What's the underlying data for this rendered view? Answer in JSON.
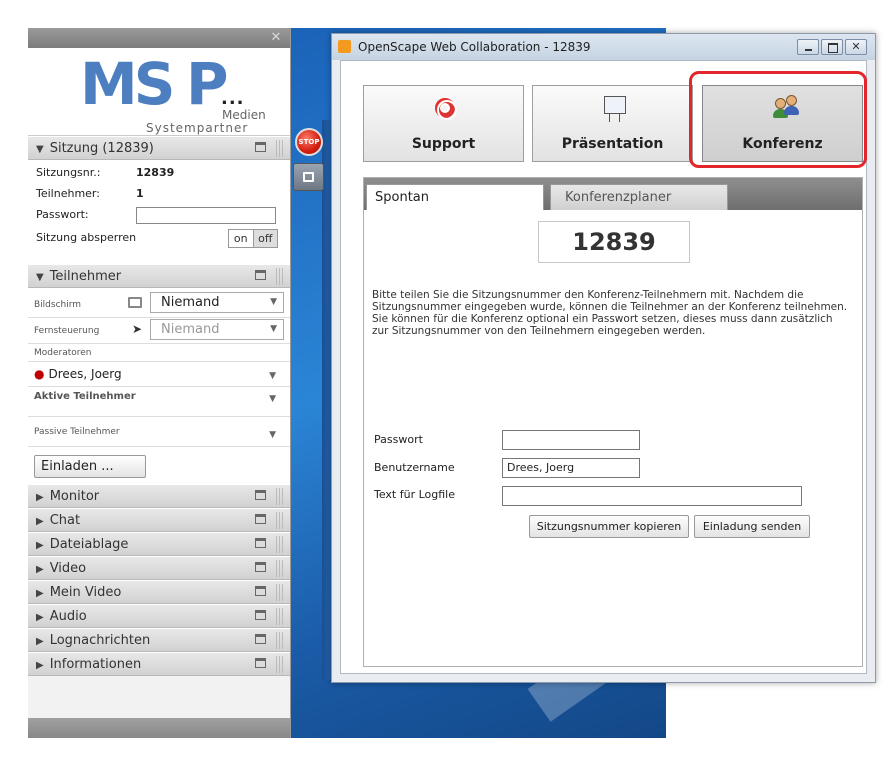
{
  "left_panel": {
    "close": "✕",
    "logo": {
      "ms": "MS",
      "p": "P",
      "dots": "...",
      "medien": "Medien",
      "systempartner": "Systempartner"
    },
    "sessions_header": "Sitzung (12839)",
    "session": {
      "nr_label": "Sitzungsnr.:",
      "nr_value": "12839",
      "participants_label": "Teilnehmer:",
      "participants_value": "1",
      "password_label": "Passwort:",
      "lock_label": "Sitzung absperren",
      "toggle_on": "on",
      "toggle_off": "off"
    },
    "participants_header": "Teilnehmer",
    "participants": {
      "screen_label": "Bildschirm",
      "screen_value": "Niemand",
      "remote_label": "Fernsteuerung",
      "remote_value": "Niemand",
      "moderators_label": "Moderatoren",
      "moderator": "Drees, Joerg",
      "active_label": "Aktive Teilnehmer",
      "passive_label": "Passive Teilnehmer",
      "invite_button": "Einladen ..."
    },
    "sections": [
      "Monitor",
      "Chat",
      "Dateiablage",
      "Video",
      "Mein Video",
      "Audio",
      "Lognachrichten",
      "Informationen"
    ]
  },
  "side_buttons": {
    "stop": "STOP"
  },
  "window": {
    "title": "OpenScape Web Collaboration - 12839",
    "close": "✕",
    "modes": [
      {
        "label": "Support"
      },
      {
        "label": "Präsentation"
      },
      {
        "label": "Konferenz"
      }
    ],
    "tabs": [
      "Spontan",
      "Konferenzplaner"
    ],
    "session_number": "12839",
    "description": "Bitte teilen Sie die Sitzungsnummer den Konferenz-Teilnehmern mit. Nachdem die Sitzungsnummer eingegeben wurde, können die Teilnehmer an der Konferenz teilnehmen. Sie können für die Konferenz optional ein Passwort setzen, dieses muss dann zusätzlich zur Sitzungsnummer von den Teilnehmern eingegeben werden.",
    "form": {
      "password_label": "Passwort",
      "password_value": "",
      "username_label": "Benutzername",
      "username_value": "Drees, Joerg",
      "logtext_label": "Text für Logfile",
      "logtext_value": ""
    },
    "copy_button": "Sitzungsnummer kopieren",
    "send_button": "Einladung senden"
  },
  "colors": {
    "accent": "#4d7fc0",
    "highlight": "#e3262b",
    "stop": "#d21f10"
  }
}
